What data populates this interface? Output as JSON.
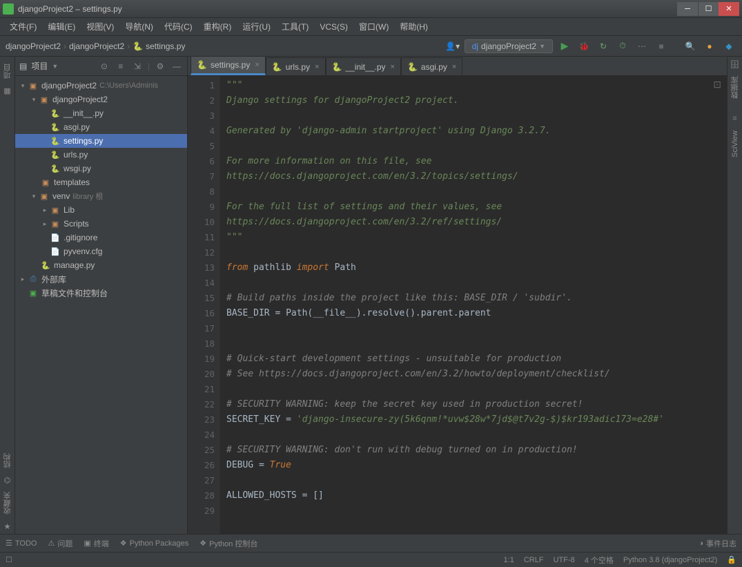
{
  "window": {
    "title": "djangoProject2 – settings.py"
  },
  "menu": [
    "文件(F)",
    "编辑(E)",
    "视图(V)",
    "导航(N)",
    "代码(C)",
    "重构(R)",
    "运行(U)",
    "工具(T)",
    "VCS(S)",
    "窗口(W)",
    "帮助(H)"
  ],
  "breadcrumb": [
    "djangoProject2",
    "djangoProject2",
    "settings.py"
  ],
  "runconfig": "djangoProject2",
  "project_header": "项目",
  "tree": {
    "root": {
      "name": "djangoProject2",
      "hint": "C:\\Users\\Adminis"
    },
    "pkg": "djangoProject2",
    "files_pkg": [
      "__init__.py",
      "asgi.py",
      "settings.py",
      "urls.py",
      "wsgi.py"
    ],
    "templates": "templates",
    "venv": {
      "name": "venv",
      "hint": "library 根"
    },
    "venv_dirs": [
      "Lib",
      "Scripts"
    ],
    "venv_files": [
      ".gitignore",
      "pyvenv.cfg"
    ],
    "manage": "manage.py",
    "external": "外部库",
    "scratch": "草稿文件和控制台"
  },
  "tabs": [
    {
      "name": "settings.py",
      "active": true
    },
    {
      "name": "urls.py",
      "active": false
    },
    {
      "name": "__init__.py",
      "active": false
    },
    {
      "name": "asgi.py",
      "active": false
    }
  ],
  "code_lines": [
    {
      "n": 1,
      "cls": "c-str",
      "t": "\"\"\""
    },
    {
      "n": 2,
      "cls": "c-str",
      "t": "Django settings for djangoProject2 project."
    },
    {
      "n": 3,
      "cls": "c-str",
      "t": ""
    },
    {
      "n": 4,
      "cls": "c-str",
      "t": "Generated by 'django-admin startproject' using Django 3.2.7."
    },
    {
      "n": 5,
      "cls": "c-str",
      "t": ""
    },
    {
      "n": 6,
      "cls": "c-str",
      "t": "For more information on this file, see"
    },
    {
      "n": 7,
      "cls": "c-str",
      "t": "https://docs.djangoproject.com/en/3.2/topics/settings/"
    },
    {
      "n": 8,
      "cls": "c-str",
      "t": ""
    },
    {
      "n": 9,
      "cls": "c-str",
      "t": "For the full list of settings and their values, see"
    },
    {
      "n": 10,
      "cls": "c-str",
      "t": "https://docs.djangoproject.com/en/3.2/ref/settings/"
    },
    {
      "n": 11,
      "cls": "c-str",
      "t": "\"\"\""
    },
    {
      "n": 12,
      "cls": "",
      "t": ""
    },
    {
      "n": 13,
      "cls": "",
      "html": "<span class='c-kw'>from</span> <span class='c-ident'>pathlib</span> <span class='c-kw'>import</span> <span class='c-ident'>Path</span>"
    },
    {
      "n": 14,
      "cls": "",
      "t": ""
    },
    {
      "n": 15,
      "cls": "c-cmt",
      "t": "# Build paths inside the project like this: BASE_DIR / 'subdir'."
    },
    {
      "n": 16,
      "cls": "",
      "html": "<span class='c-ident'>BASE_DIR = Path(__file__).resolve().parent.parent</span>"
    },
    {
      "n": 17,
      "cls": "",
      "t": ""
    },
    {
      "n": 18,
      "cls": "",
      "t": ""
    },
    {
      "n": 19,
      "cls": "c-cmt",
      "t": "# Quick-start development settings - unsuitable for production"
    },
    {
      "n": 20,
      "cls": "c-cmt",
      "t": "# See https://docs.djangoproject.com/en/3.2/howto/deployment/checklist/"
    },
    {
      "n": 21,
      "cls": "",
      "t": ""
    },
    {
      "n": 22,
      "cls": "c-cmt",
      "t": "# SECURITY WARNING: keep the secret key used in production secret!"
    },
    {
      "n": 23,
      "cls": "",
      "html": "<span class='c-ident'>SECRET_KEY = </span><span class='c-str'>'django-insecure-zy(5k6qnm!*uvw$28w*7jd$@t7v2g-$)$kr193adic173=e28#'</span>"
    },
    {
      "n": 24,
      "cls": "",
      "t": ""
    },
    {
      "n": 25,
      "cls": "c-cmt",
      "t": "# SECURITY WARNING: don't run with debug turned on in production!"
    },
    {
      "n": 26,
      "cls": "",
      "html": "<span class='c-ident'>DEBUG = </span><span class='c-kw'>True</span>"
    },
    {
      "n": 27,
      "cls": "",
      "t": ""
    },
    {
      "n": 28,
      "cls": "",
      "html": "<span class='c-ident'>ALLOWED_HOSTS = []</span>"
    },
    {
      "n": 29,
      "cls": "",
      "t": ""
    }
  ],
  "bottom": {
    "todo": "TODO",
    "problems": "问题",
    "terminal": "终端",
    "pypkg": "Python Packages",
    "pycon": "Python 控制台",
    "eventlog": "事件日志"
  },
  "status": {
    "pos": "1:1",
    "eol": "CRLF",
    "enc": "UTF-8",
    "indent": "4 个空格",
    "interp": "Python 3.8 (djangoProject2)"
  },
  "left_tabs": {
    "project": "项目",
    "structure": "结构",
    "favorites": "收藏夹"
  },
  "right_tabs": {
    "database": "数据库",
    "sciview": "SciView"
  }
}
